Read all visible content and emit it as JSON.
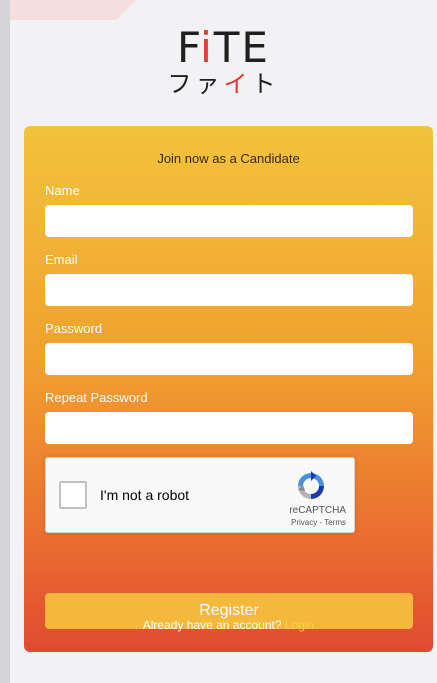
{
  "logo": {
    "word_before": "F",
    "word_accent": "i",
    "word_after": "TE",
    "kana_before": "ファ",
    "kana_accent": "イ",
    "kana_after": "ト"
  },
  "form": {
    "title": "Join now as a Candidate",
    "fields": [
      {
        "label": "Name",
        "value": "",
        "placeholder": ""
      },
      {
        "label": "Email",
        "value": "",
        "placeholder": ""
      },
      {
        "label": "Password",
        "value": "",
        "placeholder": ""
      },
      {
        "label": "Repeat Password",
        "value": "",
        "placeholder": ""
      }
    ],
    "register_label": "Register",
    "login_prompt": "Already have an account?",
    "login_link": "Login"
  },
  "recaptcha": {
    "label": "I'm not a robot",
    "brand": "reCAPTCHA",
    "links": "Privacy - Terms",
    "icon": "recaptcha-logo-icon",
    "checked": false
  },
  "colors": {
    "accent_red": "#e53935",
    "card_top": "#f2c33c",
    "card_bottom": "#e04a30",
    "button": "#f3b83c",
    "login_link": "#f7d23f"
  }
}
